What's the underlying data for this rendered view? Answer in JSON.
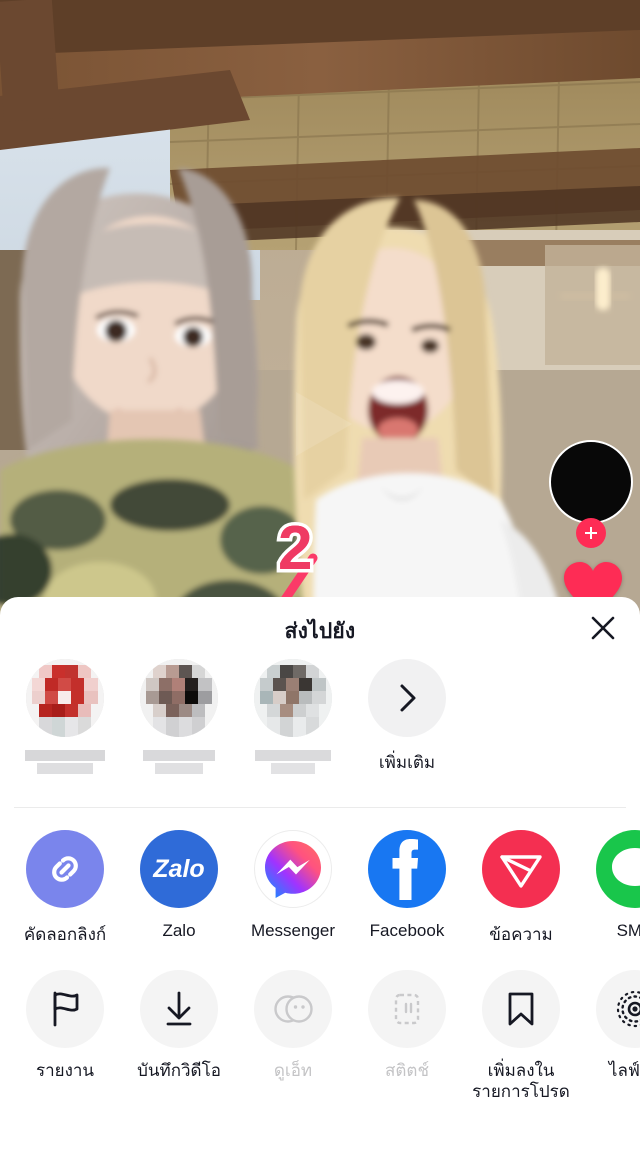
{
  "video": {
    "description": "two women dancing under wooden pergola with brick wall",
    "avatar_name": "creator-avatar",
    "follow_icon": "plus-icon",
    "like_icon": "heart-icon"
  },
  "annotation": {
    "step_number": "2",
    "arrow_color": "#fb3a68",
    "highlight_color": "#fb3a68"
  },
  "sheet": {
    "title": "ส่งไปยัง",
    "close_icon": "close-icon",
    "friends": [
      {
        "name_redacted": true,
        "tint": "#c9302c"
      },
      {
        "name_redacted": true,
        "tint": "#6b5250"
      },
      {
        "name_redacted": true,
        "tint": "#7d7a78"
      }
    ],
    "more": {
      "label": "เพิ่มเติม",
      "icon": "chevron-right-icon"
    },
    "apps": [
      {
        "label": "คัดลอกลิงก์",
        "icon": "link-icon",
        "bg": "#7a85ec",
        "highlighted": true
      },
      {
        "label": "Zalo",
        "icon": "zalo-icon",
        "bg": "#2f6bd8",
        "highlighted": false
      },
      {
        "label": "Messenger",
        "icon": "messenger-icon",
        "bg": "#ffffff",
        "highlighted": false
      },
      {
        "label": "Facebook",
        "icon": "facebook-icon",
        "bg": "#1877f2",
        "highlighted": false
      },
      {
        "label": "ข้อความ",
        "icon": "send-triangle-icon",
        "bg": "#f42f51",
        "highlighted": false
      },
      {
        "label": "SMS",
        "icon": "sms-bubble-icon",
        "bg": "#19c64b",
        "highlighted": false
      }
    ],
    "actions": [
      {
        "label": "รายงาน",
        "icon": "flag-icon",
        "disabled": false
      },
      {
        "label": "บันทึกวิดีโอ",
        "icon": "download-icon",
        "disabled": false
      },
      {
        "label": "ดูเอ็ท",
        "icon": "duet-icon",
        "disabled": true
      },
      {
        "label": "สติตช์",
        "icon": "stitch-icon",
        "disabled": true
      },
      {
        "label": "เพิ่มลงใน\nรายการโปรด",
        "icon": "bookmark-icon",
        "disabled": false
      },
      {
        "label": "ไลฟ์โฟ",
        "icon": "live-photo-icon",
        "disabled": false
      }
    ]
  },
  "colors": {
    "accent_pink": "#fe2c55",
    "annotation_pink": "#fb3a68",
    "sheet_bg": "#ffffff",
    "text_primary": "#161823",
    "text_disabled": "#c4c4c6",
    "icon_bg_grey": "#f4f4f4"
  }
}
